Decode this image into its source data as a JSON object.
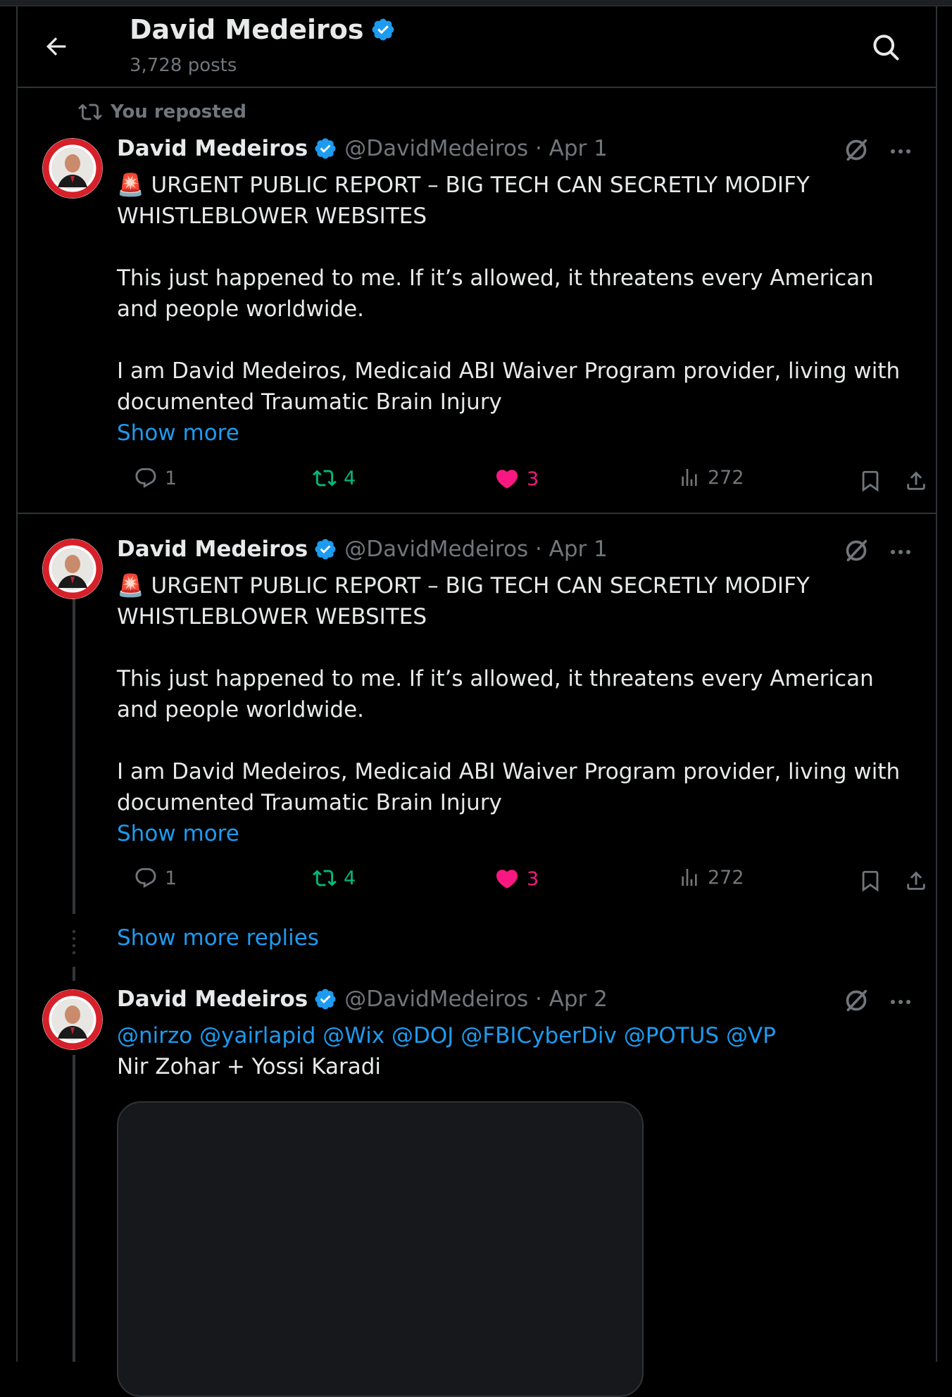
{
  "header": {
    "title": "David Medeiros",
    "post_count": "3,728 posts"
  },
  "repost_banner": "You reposted",
  "posts": [
    {
      "name": "David Medeiros",
      "handle_date": "@DavidMedeiros · Apr 1",
      "line1": "🚨 URGENT PUBLIC REPORT – BIG TECH CAN SECRETLY MODIFY",
      "line2": "WHISTLEBLOWER WEBSITES",
      "para2": "This just happened to me. If it’s allowed, it threatens every American and people worldwide.",
      "para3": "I am David Medeiros, Medicaid ABI Waiver Program provider, living with documented Traumatic Brain Injury",
      "show_more": "Show more",
      "replies": "1",
      "reposts": "4",
      "likes": "3",
      "views": "272"
    },
    {
      "name": "David Medeiros",
      "handle_date": "@DavidMedeiros · Apr 1",
      "line1": "🚨 URGENT PUBLIC REPORT – BIG TECH CAN SECRETLY MODIFY",
      "line2": "WHISTLEBLOWER WEBSITES",
      "para2": "This just happened to me. If it’s allowed, it threatens every American and people worldwide.",
      "para3": "I am David Medeiros, Medicaid ABI Waiver Program provider, living with documented Traumatic Brain Injury",
      "show_more": "Show more",
      "replies": "1",
      "reposts": "4",
      "likes": "3",
      "views": "272"
    },
    {
      "name": "David Medeiros",
      "handle_date": "@DavidMedeiros · Apr 2",
      "mentions": "@nirzo @yairlapid @Wix @DOJ @FBICyberDiv @POTUS @VP",
      "text": "Nir Zohar + Yossi Karadi"
    }
  ],
  "show_more_replies": "Show more replies",
  "colors": {
    "background": "#000000",
    "accent_blue": "#1d9bf0",
    "repost_green": "#00ba7c",
    "like_pink": "#f91880",
    "muted": "#71767b",
    "border": "#2f3336"
  }
}
